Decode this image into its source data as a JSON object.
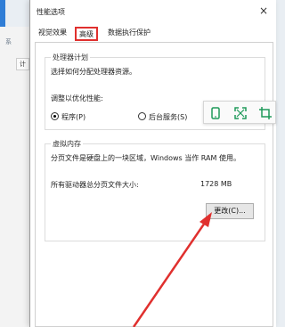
{
  "dialog": {
    "title": "性能选项",
    "close_glyph": "×"
  },
  "tabs": [
    {
      "label": "视觉效果"
    },
    {
      "label": "高级"
    },
    {
      "label": "数据执行保护"
    }
  ],
  "processor": {
    "group_title": "处理器计划",
    "description": "选择如何分配处理器资源。",
    "optimize_label": "调整以优化性能:",
    "options": [
      {
        "label": "程序(P)",
        "checked": true
      },
      {
        "label": "后台服务(S)",
        "checked": false
      }
    ]
  },
  "virtual_memory": {
    "group_title": "虚拟内存",
    "description": "分页文件是硬盘上的一块区域，Windows 当作 RAM 使用。",
    "total_label": "所有驱动器总分页文件大小:",
    "total_value": "1728 MB",
    "change_button": "更改(C)..."
  },
  "background": {
    "tab_label": "计",
    "title_fragment": "系"
  },
  "colors": {
    "highlight": "#e0302e",
    "toolbar_icon": "#1f9a5a"
  },
  "toolbar_icons": [
    "phone-icon",
    "expand-icon",
    "crop-icon"
  ]
}
